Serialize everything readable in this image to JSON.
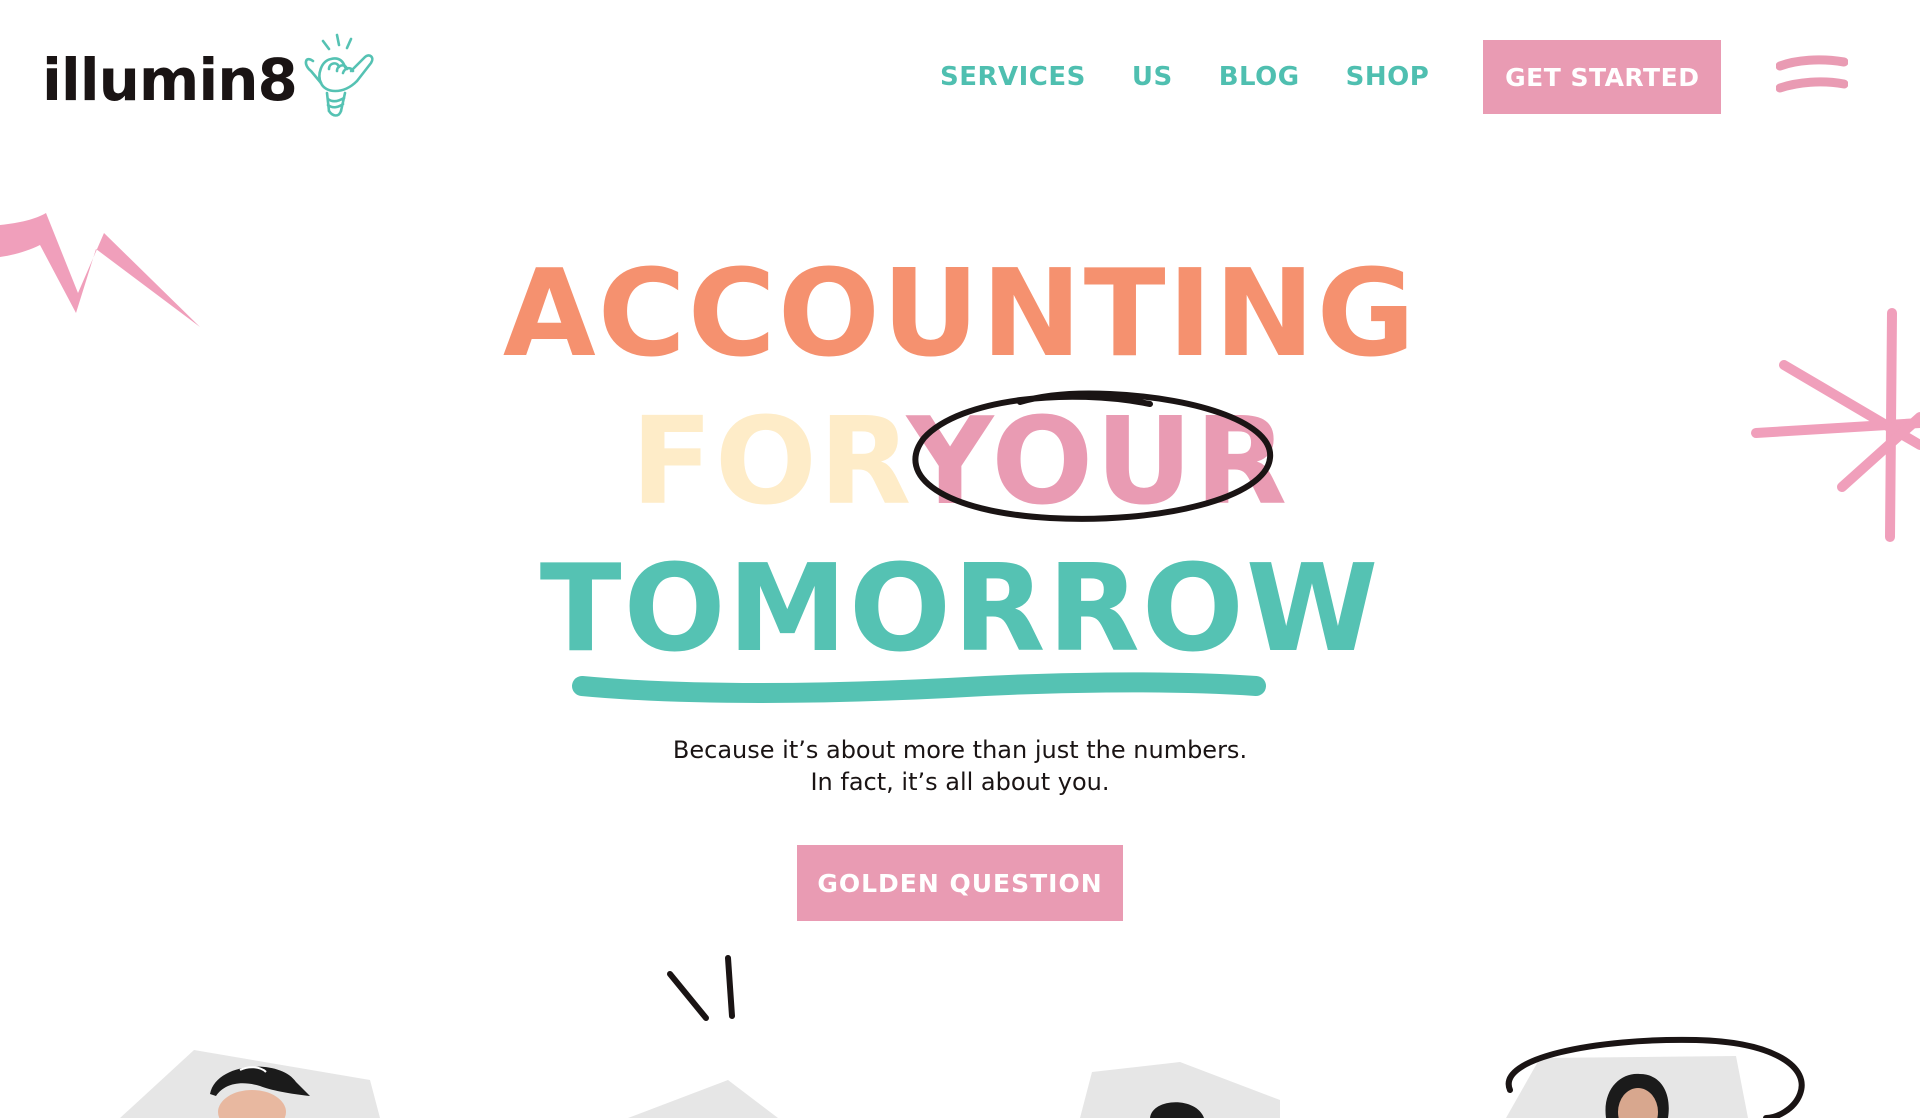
{
  "header": {
    "logo_text": "illumin8",
    "logo_icon": "shaka-hand-lightbulb-icon",
    "nav": [
      {
        "label": "SERVICES"
      },
      {
        "label": "US"
      },
      {
        "label": "BLOG"
      },
      {
        "label": "SHOP"
      }
    ],
    "cta_label": "GET STARTED",
    "menu_icon": "menu-icon"
  },
  "hero": {
    "line1": "ACCOUNTING",
    "line2_a": "FOR",
    "line2_b": "YOUR",
    "line3": "TOMORROW",
    "subtitle_line1": "Because it’s about more than just the numbers.",
    "subtitle_line2": "In fact, it’s all about you.",
    "cta_label": "GOLDEN QUESTION"
  },
  "colors": {
    "coral": "#f5916f",
    "cream": "#feecc8",
    "pink": "#e99bb3",
    "teal": "#55c2b3",
    "ink": "#1a1414"
  },
  "team": {
    "photos": [
      "person-in-cap-photo",
      "person-photo",
      "person-photo",
      "person-photo"
    ]
  }
}
